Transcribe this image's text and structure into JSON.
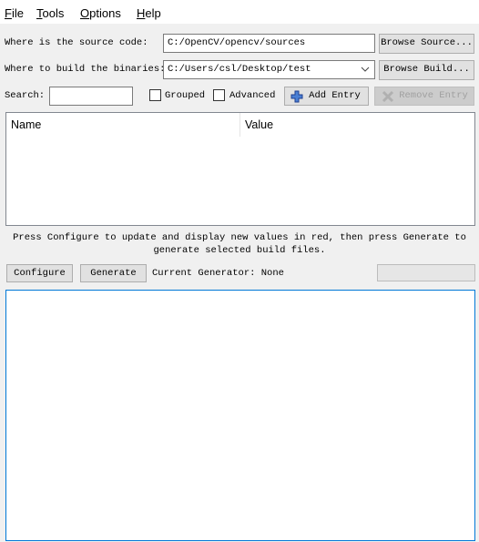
{
  "menu": [
    {
      "label": "File",
      "key": "F",
      "rest": "ile"
    },
    {
      "label": "Tools",
      "key": "T",
      "rest": "ools"
    },
    {
      "label": "Options",
      "key": "O",
      "rest": "ptions"
    },
    {
      "label": "Help",
      "key": "H",
      "rest": "elp"
    }
  ],
  "source": {
    "label": "Where is the source code:",
    "value": "C:/OpenCV/opencv/sources",
    "button": "Browse Source..."
  },
  "build": {
    "label": "Where to build the binaries:",
    "value": "C:/Users/csl/Desktop/test",
    "button": "Browse Build..."
  },
  "search": {
    "label": "Search:",
    "value": ""
  },
  "options": {
    "grouped": "Grouped",
    "grouped_checked": false,
    "advanced": "Advanced",
    "advanced_checked": false
  },
  "add_entry": "Add Entry",
  "remove_entry": "Remove Entry",
  "table": {
    "columns": [
      "Name",
      "Value"
    ]
  },
  "hint": {
    "line1": "Press Configure to update and display new values in red, then press Generate to",
    "line2": "generate selected build files."
  },
  "configure": "Configure",
  "generate": "Generate",
  "generator": "Current Generator: None",
  "progress": 0,
  "accent": "#0078d7"
}
